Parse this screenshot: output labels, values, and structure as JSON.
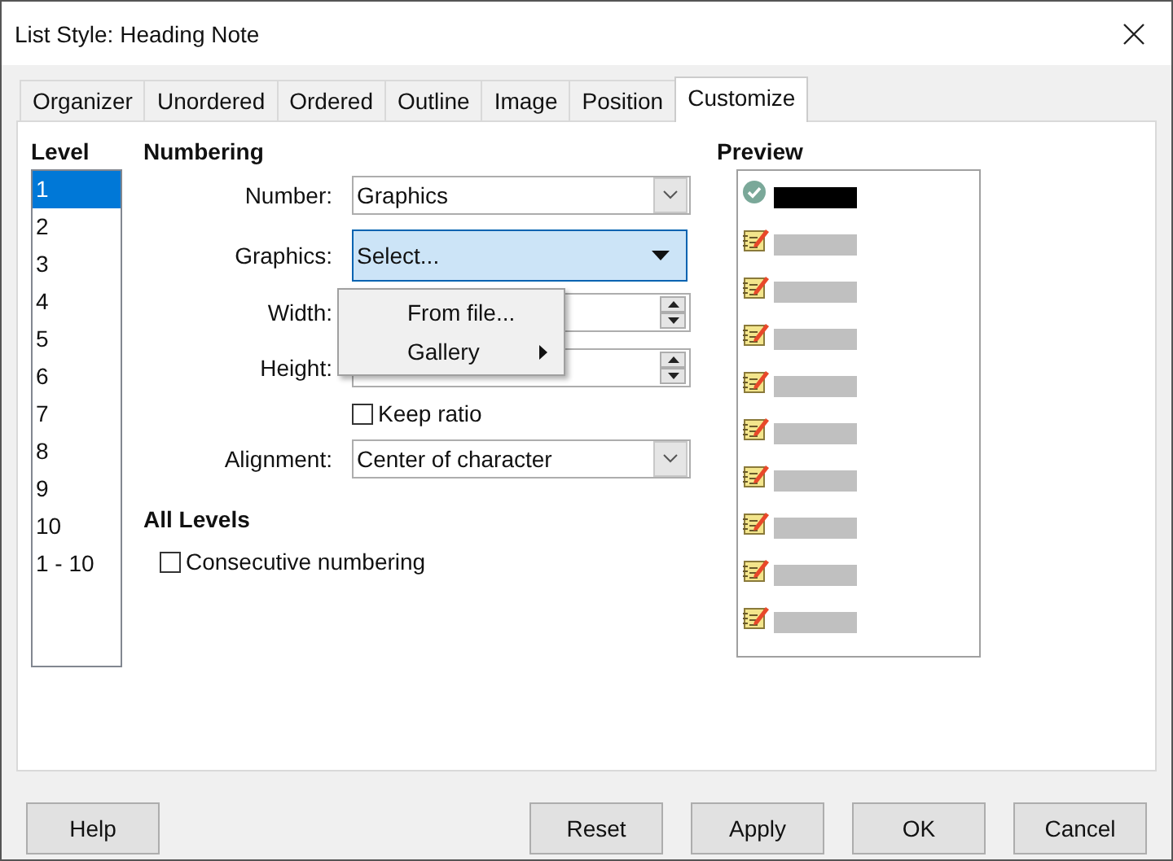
{
  "window": {
    "title": "List Style: Heading Note"
  },
  "tabs": [
    {
      "label": "Organizer",
      "selected": false
    },
    {
      "label": "Unordered",
      "selected": false
    },
    {
      "label": "Ordered",
      "selected": false
    },
    {
      "label": "Outline",
      "selected": false
    },
    {
      "label": "Image",
      "selected": false
    },
    {
      "label": "Position",
      "selected": false
    },
    {
      "label": "Customize",
      "selected": true
    }
  ],
  "level": {
    "label": "Level",
    "items": [
      {
        "label": "1",
        "selected": true
      },
      {
        "label": "2",
        "selected": false
      },
      {
        "label": "3",
        "selected": false
      },
      {
        "label": "4",
        "selected": false
      },
      {
        "label": "5",
        "selected": false
      },
      {
        "label": "6",
        "selected": false
      },
      {
        "label": "7",
        "selected": false
      },
      {
        "label": "8",
        "selected": false
      },
      {
        "label": "9",
        "selected": false
      },
      {
        "label": "10",
        "selected": false
      },
      {
        "label": "1 - 10",
        "selected": false
      }
    ]
  },
  "numbering": {
    "heading": "Numbering",
    "fields": [
      {
        "kind": "dropdown",
        "label": "Number:",
        "value": "Graphics"
      },
      {
        "kind": "menubutton",
        "label": "Graphics:",
        "value": "Select..."
      },
      {
        "kind": "spin",
        "label": "Width:"
      },
      {
        "kind": "spin",
        "label": "Height:"
      },
      {
        "kind": "checkbox",
        "label": "Keep ratio",
        "checked": false
      },
      {
        "kind": "dropdown",
        "label": "Alignment:",
        "value": "Center of character"
      }
    ]
  },
  "all_levels": {
    "heading": "All Levels",
    "checkbox": {
      "label": "Consecutive numbering",
      "checked": false
    }
  },
  "preview": {
    "heading": "Preview",
    "items": [
      {
        "kind": "check",
        "selected": true
      },
      {
        "kind": "notepad",
        "selected": false
      },
      {
        "kind": "notepad",
        "selected": false
      },
      {
        "kind": "notepad",
        "selected": false
      },
      {
        "kind": "notepad",
        "selected": false
      },
      {
        "kind": "notepad",
        "selected": false
      },
      {
        "kind": "notepad",
        "selected": false
      },
      {
        "kind": "notepad",
        "selected": false
      },
      {
        "kind": "notepad",
        "selected": false
      },
      {
        "kind": "notepad",
        "selected": false
      }
    ]
  },
  "popup_menu": {
    "items": [
      {
        "label": "From file...",
        "submenu": false
      },
      {
        "label": "Gallery",
        "submenu": true
      }
    ]
  },
  "buttons": [
    {
      "label": "Help"
    },
    {
      "label": "Reset"
    },
    {
      "label": "Apply"
    },
    {
      "label": "OK"
    },
    {
      "label": "Cancel"
    }
  ]
}
